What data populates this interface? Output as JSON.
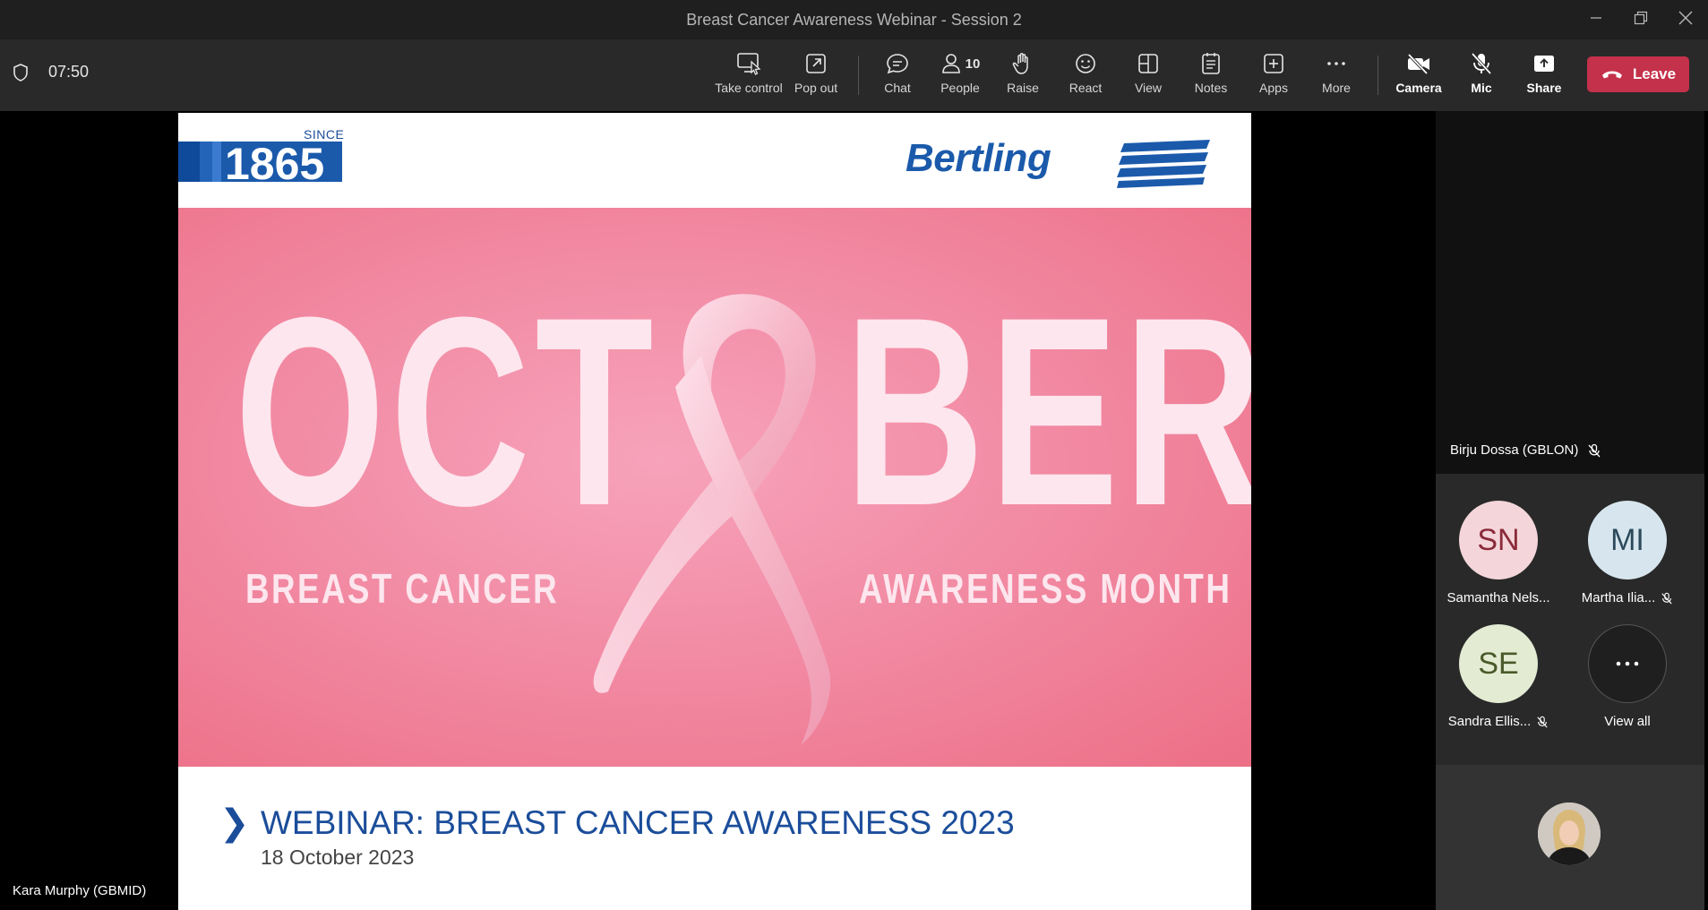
{
  "window": {
    "title": "Breast Cancer Awareness Webinar - Session 2"
  },
  "meeting": {
    "elapsed": "07:50"
  },
  "toolbar": {
    "take_control": "Take control",
    "pop_out": "Pop out",
    "chat": "Chat",
    "people": "People",
    "people_count": "10",
    "raise": "Raise",
    "react": "React",
    "view": "View",
    "notes": "Notes",
    "apps": "Apps",
    "more": "More",
    "camera": "Camera",
    "mic": "Mic",
    "share": "Share",
    "leave": "Leave"
  },
  "slide": {
    "since": "SINCE",
    "year": "1865",
    "brand": "Bertling",
    "word_left": "OCT",
    "word_right": "BER",
    "sub_left": "BREAST CANCER",
    "sub_right": "AWARENESS MONTH",
    "webinar_title": "WEBINAR: BREAST CANCER AWARENESS 2023",
    "webinar_date": "18 October 2023"
  },
  "presenter": {
    "name": "Kara Murphy (GBMID)"
  },
  "participants": {
    "video": {
      "name": "Birju Dossa (GBLON)"
    },
    "gallery": [
      {
        "initials": "SN",
        "name": "Samantha Nels...",
        "muted": false,
        "bg": "#f4d6da",
        "fg": "#8a2a3a"
      },
      {
        "initials": "MI",
        "name": "Martha Ilia...",
        "muted": true,
        "bg": "#d7e6ee",
        "fg": "#2c4a5c"
      },
      {
        "initials": "SE",
        "name": "Sandra Ellis...",
        "muted": true,
        "bg": "#e3ecd3",
        "fg": "#4a5a2a"
      }
    ],
    "view_all": "View all"
  },
  "colors": {
    "leave": "#c4314b",
    "toolbar": "#292929",
    "brand_blue": "#1b4d9a"
  }
}
